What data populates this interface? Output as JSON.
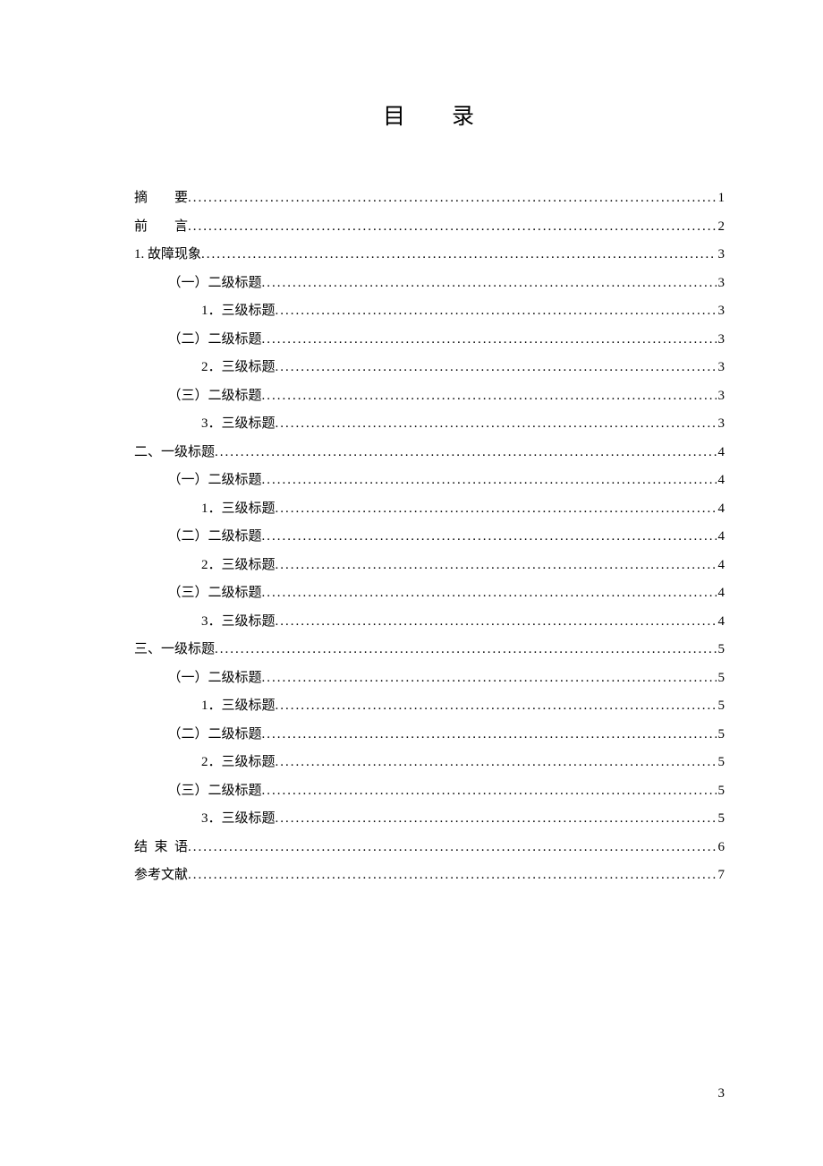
{
  "title_char1": "目",
  "title_char2": "录",
  "page_number": "3",
  "entries": [
    {
      "label_parts": [
        "摘",
        "要"
      ],
      "spaced": "two",
      "page": "1",
      "indent": 0
    },
    {
      "label_parts": [
        "前",
        "言"
      ],
      "spaced": "two",
      "page": "2",
      "indent": 0
    },
    {
      "label": "1. 故障现象",
      "page": "3",
      "indent": 0
    },
    {
      "label": "（一）二级标题",
      "page": "3",
      "indent": 1
    },
    {
      "label": "1．三级标题",
      "page": "3",
      "indent": 2
    },
    {
      "label": "（二）二级标题",
      "page": "3",
      "indent": 1
    },
    {
      "label": "2．三级标题",
      "page": "3",
      "indent": 2
    },
    {
      "label": "（三）二级标题",
      "page": "3",
      "indent": 1
    },
    {
      "label": "3．三级标题",
      "page": "3",
      "indent": 2
    },
    {
      "label": "二、一级标题",
      "page": "4",
      "indent": 0
    },
    {
      "label": "（一）二级标题",
      "page": "4",
      "indent": 1
    },
    {
      "label": "1．三级标题",
      "page": "4",
      "indent": 2
    },
    {
      "label": "（二）二级标题",
      "page": "4",
      "indent": 1
    },
    {
      "label": "2．三级标题",
      "page": "4",
      "indent": 2
    },
    {
      "label": "（三）二级标题",
      "page": "4",
      "indent": 1
    },
    {
      "label": "3．三级标题",
      "page": "4",
      "indent": 2
    },
    {
      "label": "三、一级标题",
      "page": "5",
      "indent": 0
    },
    {
      "label": "（一）二级标题",
      "page": "5",
      "indent": 1
    },
    {
      "label": "1．三级标题",
      "page": "5",
      "indent": 2
    },
    {
      "label": "（二）二级标题",
      "page": "5",
      "indent": 1
    },
    {
      "label": "2．三级标题",
      "page": "5",
      "indent": 2
    },
    {
      "label": "（三）二级标题",
      "page": "5",
      "indent": 1
    },
    {
      "label": "3．三级标题",
      "page": "5",
      "indent": 2
    },
    {
      "label_parts": [
        "结",
        "束",
        "语"
      ],
      "spaced": "half",
      "page": "6",
      "indent": 0
    },
    {
      "label": "参考文献",
      "page": "7",
      "indent": 0
    }
  ]
}
